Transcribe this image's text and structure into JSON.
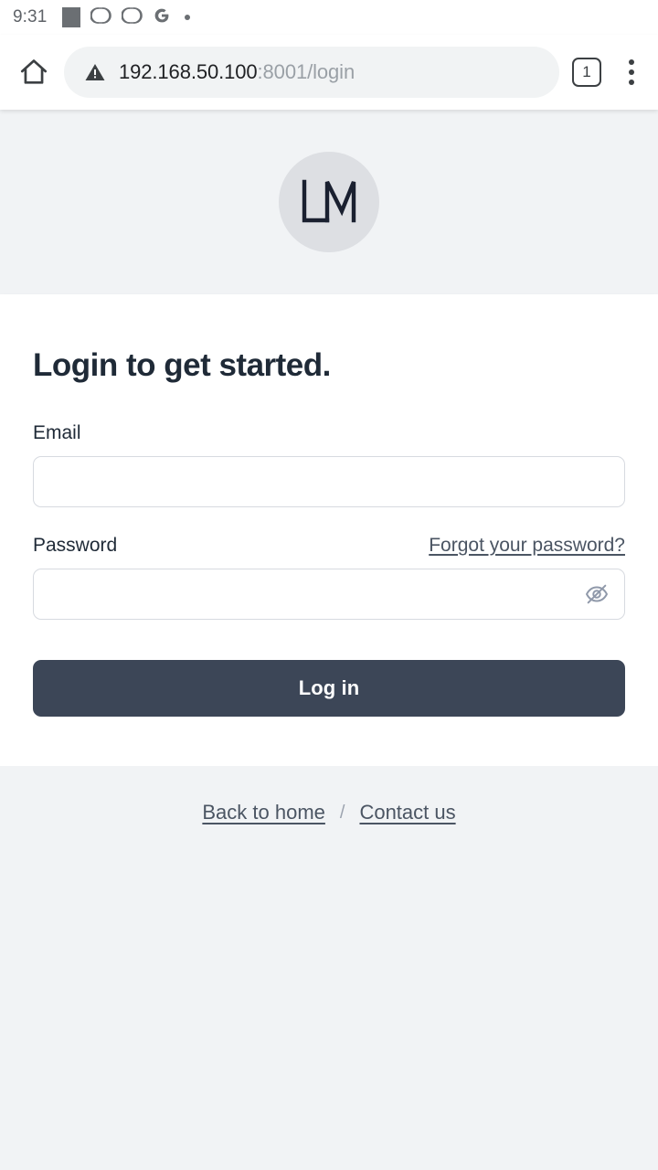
{
  "status_bar": {
    "time": "9:31",
    "icons": [
      {
        "name": "app-placeholder-square-icon"
      },
      {
        "name": "venn-overlap-icon"
      },
      {
        "name": "venn-overlap-icon"
      },
      {
        "name": "google-g-icon"
      },
      {
        "name": "notification-dot-icon"
      }
    ]
  },
  "browser": {
    "home_icon": "home-icon",
    "security_icon": "not-secure-warning-icon",
    "url_host": "192.168.50.100",
    "url_rest": ":8001/login",
    "tab_count": "1",
    "overflow_icon": "three-dot-menu-icon"
  },
  "page": {
    "logo": {
      "text": "LM",
      "circle_color": "#dddfe3",
      "text_color": "#1a2030"
    },
    "title": "Login to get started.",
    "email": {
      "label": "Email",
      "value": "",
      "placeholder": ""
    },
    "password": {
      "label": "Password",
      "forgot_link": "Forgot your password?",
      "value": "",
      "placeholder": "",
      "visibility_icon": "eye-off-icon"
    },
    "submit_label": "Log in",
    "footer": {
      "back_link": "Back to home",
      "separator": "/",
      "contact_link": "Contact us"
    }
  },
  "colors": {
    "page_background": "#f1f3f5",
    "card_background": "#ffffff",
    "primary_button": "#3c4657",
    "text_primary": "#1f2a37",
    "text_muted": "#4b5563",
    "input_border": "#d7dae0"
  }
}
